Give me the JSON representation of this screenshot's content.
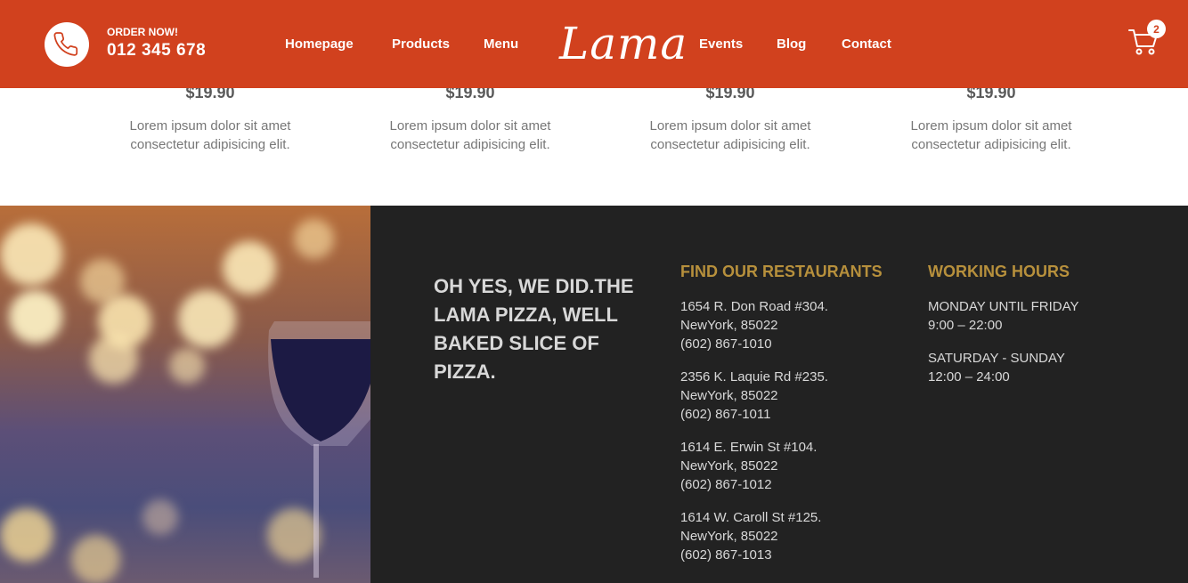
{
  "header": {
    "order_label": "ORDER NOW!",
    "phone": "012 345 678",
    "logo": "Lama",
    "cart_count": "2",
    "nav": [
      "Homepage",
      "Products",
      "Menu",
      "Events",
      "Blog",
      "Contact"
    ]
  },
  "products": [
    {
      "price": "$19.90",
      "desc1": "Lorem ipsum dolor sit amet",
      "desc2": "consectetur adipisicing elit."
    },
    {
      "price": "$19.90",
      "desc1": "Lorem ipsum dolor sit amet",
      "desc2": "consectetur adipisicing elit."
    },
    {
      "price": "$19.90",
      "desc1": "Lorem ipsum dolor sit amet",
      "desc2": "consectetur adipisicing elit."
    },
    {
      "price": "$19.90",
      "desc1": "Lorem ipsum dolor sit amet",
      "desc2": "consectetur adipisicing elit."
    }
  ],
  "footer": {
    "slogan": [
      "OH YES, WE DID.THE",
      "LAMA PIZZA, WELL",
      "BAKED SLICE OF",
      "PIZZA."
    ],
    "restaurants_title": "FIND OUR RESTAURANTS",
    "restaurants": [
      {
        "street": "1654 R. Don Road #304.",
        "city": "NewYork, 85022",
        "phone": "(602) 867-1010"
      },
      {
        "street": "2356 K. Laquie Rd #235.",
        "city": "NewYork, 85022",
        "phone": "(602) 867-1011"
      },
      {
        "street": "1614 E. Erwin St #104.",
        "city": "NewYork, 85022",
        "phone": "(602) 867-1012"
      },
      {
        "street": "1614 W. Caroll St #125.",
        "city": "NewYork, 85022",
        "phone": "(602) 867-1013"
      }
    ],
    "hours_title": "WORKING HOURS",
    "hours": [
      {
        "days": "MONDAY UNTIL FRIDAY",
        "time": "9:00 – 22:00"
      },
      {
        "days": "SATURDAY - SUNDAY",
        "time": "12:00 – 24:00"
      }
    ]
  },
  "colors": {
    "brand": "#d1411e",
    "footer_bg": "#222222",
    "accent": "#b7903c"
  }
}
